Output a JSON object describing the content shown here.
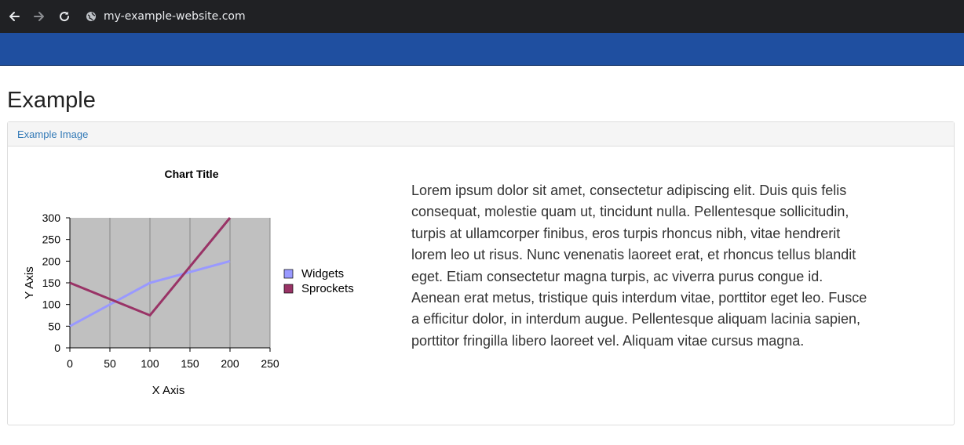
{
  "browser": {
    "url": "my-example-website.com"
  },
  "page": {
    "title": "Example",
    "panel_heading": "Example Image",
    "paragraph": "Lorem ipsum dolor sit amet, consectetur adipiscing elit. Duis quis felis consequat, molestie quam ut, tincidunt nulla. Pellentesque sollicitudin, turpis at ullamcorper finibus, eros turpis rhoncus nibh, vitae hendrerit lorem leo ut risus. Nunc venenatis laoreet erat, et rhoncus tellus blandit eget. Etiam consectetur magna turpis, ac viverra purus congue id. Aenean erat metus, tristique quis interdum vitae, porttitor eget leo. Fusce a efficitur dolor, in interdum augue. Pellentesque aliquam lacinia sapien, porttitor fringilla libero laoreet vel. Aliquam vitae cursus magna."
  },
  "colors": {
    "header_bar": "#1f4fa0",
    "plot_background": "#c0c0c0",
    "widgets": "#9999ff",
    "sprockets": "#993366"
  },
  "chart_data": {
    "type": "line",
    "title": "Chart Title",
    "xlabel": "X Axis",
    "ylabel": "Y Axis",
    "xlim": [
      0,
      250
    ],
    "ylim": [
      0,
      300
    ],
    "x_ticks": [
      0,
      50,
      100,
      150,
      200,
      250
    ],
    "y_ticks": [
      0,
      50,
      100,
      150,
      200,
      250,
      300
    ],
    "grid": "vertical",
    "legend_position": "right",
    "series": [
      {
        "name": "Widgets",
        "x": [
          0,
          100,
          200
        ],
        "y": [
          50,
          150,
          200
        ],
        "color": "#9999ff"
      },
      {
        "name": "Sprockets",
        "x": [
          0,
          100,
          200
        ],
        "y": [
          150,
          75,
          300
        ],
        "color": "#993366"
      }
    ]
  }
}
